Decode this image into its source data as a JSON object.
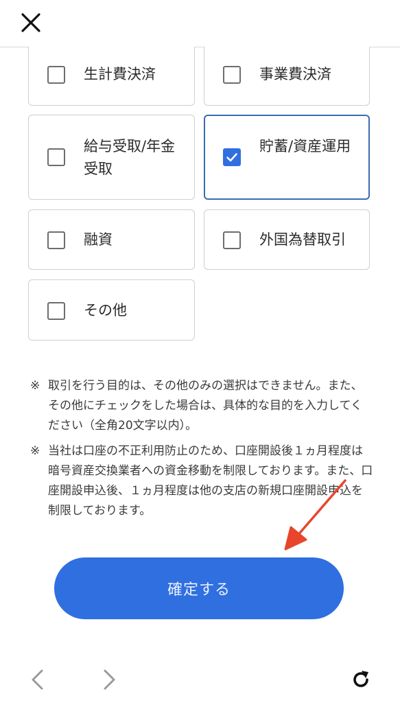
{
  "options": [
    {
      "label": "生計費決済",
      "checked": false
    },
    {
      "label": "事業費決済",
      "checked": false
    },
    {
      "label": "給与受取/年金受取",
      "checked": false
    },
    {
      "label": "貯蓄/資産運用",
      "checked": true
    },
    {
      "label": "融資",
      "checked": false
    },
    {
      "label": "外国為替取引",
      "checked": false
    },
    {
      "label": "その他",
      "checked": false
    }
  ],
  "notes": [
    {
      "mark": "※",
      "text": "取引を行う目的は、その他のみの選択はできません。また、その他にチェックをした場合は、具体的な目的を入力してください（全角20文字以内）。"
    },
    {
      "mark": "※",
      "text": "当社は口座の不正利用防止のため、口座開設後１ヵ月程度は暗号資産交換業者への資金移動を制限しております。また、口座開設申込後、１ヵ月程度は他の支店の新規口座開設申込を制限しております。"
    }
  ],
  "confirm_label": "確定する",
  "colors": {
    "accent": "#2f6fe0",
    "arrow": "#e8452c",
    "selected_border": "#3a6ab0"
  },
  "icons": {
    "close": "close-icon",
    "back": "chevron-left-icon",
    "forward": "chevron-right-icon",
    "reload": "reload-icon",
    "check": "checkmark-icon"
  }
}
